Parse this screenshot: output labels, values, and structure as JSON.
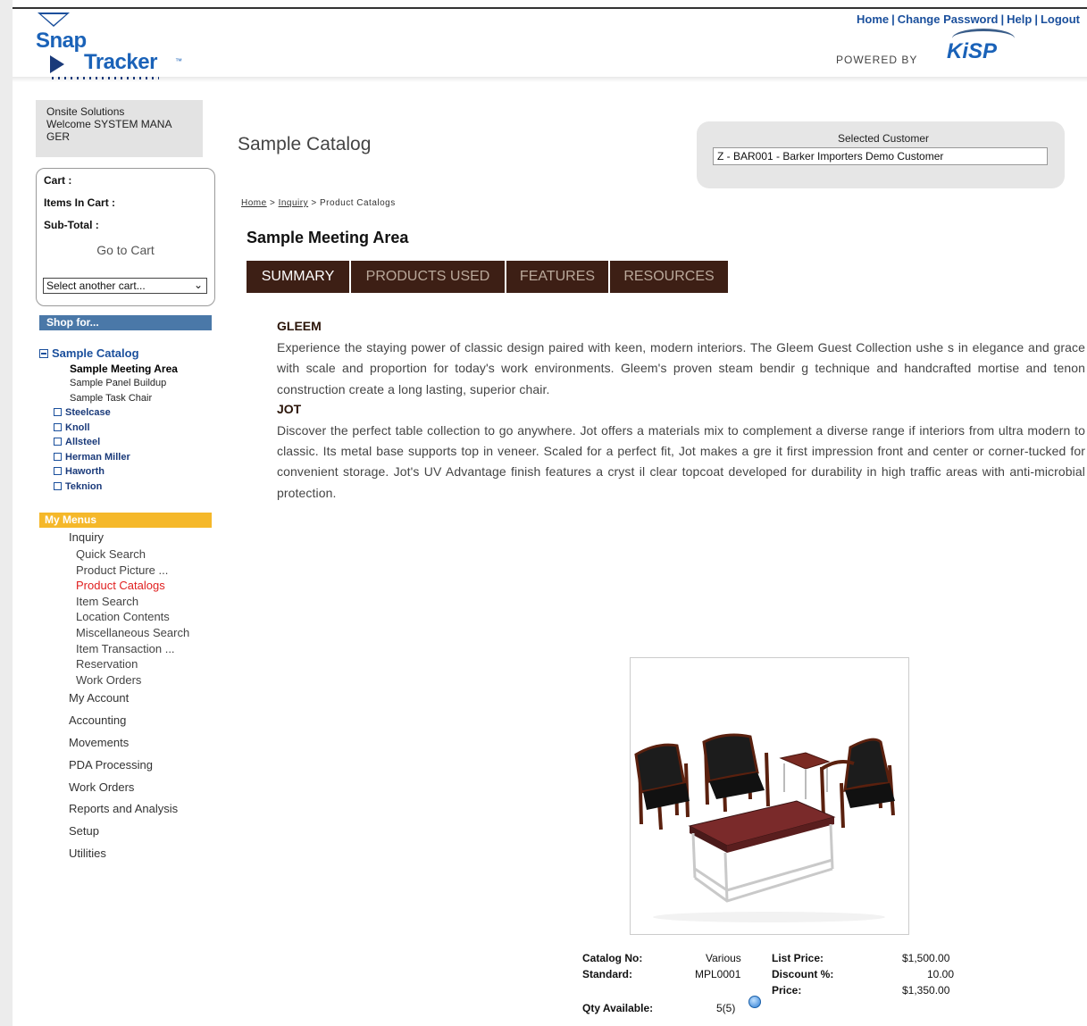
{
  "header": {
    "logo": {
      "line1": "Snap",
      "line2": "Tracker",
      "tm": "™"
    },
    "nav": [
      "Home",
      "Change Password",
      "Help",
      "Logout"
    ],
    "nav_separator": "|",
    "powered_by": "POWERED BY",
    "partner_logo": "KiSP"
  },
  "sidebar": {
    "company": "Onsite Solutions",
    "welcome": "Welcome SYSTEM MANA GER",
    "cart": {
      "cart_label": "Cart :",
      "items_label": "Items In Cart :",
      "subtotal_label": "Sub-Total :",
      "go_to_cart": "Go to Cart",
      "select_value": "Select another cart..."
    },
    "shop_for": "Shop for...",
    "tree": {
      "root": "Sample Catalog",
      "children": [
        "Sample Meeting Area",
        "Sample Panel Buildup",
        "Sample Task Chair"
      ],
      "manufacturers": [
        "Steelcase",
        "Knoll",
        "Allsteel",
        "Herman Miller",
        "Haworth",
        "Teknion"
      ]
    },
    "my_menus": "My Menus",
    "menu": {
      "inquiry": "Inquiry",
      "inquiry_items": [
        "Quick Search",
        "Product Picture ...",
        "Product Catalogs",
        "Item Search",
        "Location Contents",
        "Miscellaneous Search",
        "Item Transaction ...",
        "Reservation",
        "Work Orders"
      ],
      "groups": [
        "My Account",
        "Accounting",
        "Movements",
        "PDA Processing",
        "Work Orders",
        "Reports and Analysis",
        "Setup",
        "Utilities"
      ]
    }
  },
  "main": {
    "page_title": "Sample Catalog",
    "selected_customer_label": "Selected Customer",
    "selected_customer_value": "Z - BAR001 - Barker Importers Demo Customer",
    "breadcrumb": {
      "home": "Home",
      "inquiry": "Inquiry",
      "current": "Product Catalogs",
      "sep": ">"
    },
    "section_title": "Sample Meeting Area",
    "tabs": [
      "SUMMARY",
      "PRODUCTS USED",
      "FEATURES",
      "RESOURCES"
    ],
    "products": [
      {
        "name": "GLEEM",
        "description": "Experience the staying power of classic design paired with keen, modern interiors. The Gleem Guest Collection ushe s in elegance and grace with scale and proportion for today's work environments. Gleem's proven steam bendir g technique and handcrafted mortise and tenon construction create a long lasting, superior chair."
      },
      {
        "name": "JOT",
        "description": "Discover the perfect table collection to go anywhere. Jot offers a materials mix to complement a diverse range if interiors from ultra modern to classic. Its metal base supports top in veneer. Scaled for a perfect fit, Jot makes a gre it first impression front and center or corner-tucked for convenient storage. Jot's UV Advantage finish features a cryst il clear topcoat developed for durability in high traffic areas with anti-microbial protection."
      }
    ],
    "details": {
      "catalog_no_label": "Catalog No:",
      "catalog_no": "Various",
      "standard_label": "Standard:",
      "standard": "MPL0001",
      "qty_label": "Qty Available:",
      "qty": "5(5)",
      "list_price_label": "List Price:",
      "list_price": "$1,500.00",
      "discount_label": "Discount %:",
      "discount": "10.00",
      "price_label": "Price:",
      "price": "$1,350.00"
    }
  },
  "colors": {
    "accent_blue": "#1a4f9c",
    "tab_bg": "#3d1f15",
    "shop_bar": "#4a78a8",
    "menus_bar": "#f5b82a",
    "active_link": "#e02020"
  }
}
